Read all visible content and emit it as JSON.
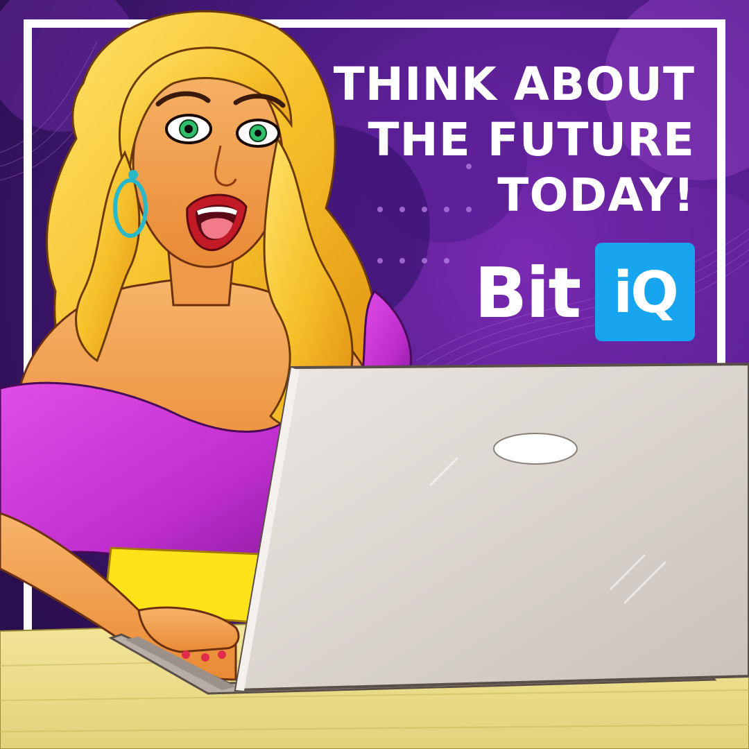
{
  "headline": {
    "line1": "THINK ABOUT",
    "line2": "THE FUTURE",
    "line3": "TODAY!"
  },
  "brand": {
    "word": "Bit",
    "badge": "iQ",
    "badge_color": "#17a5f0"
  },
  "colors": {
    "background": "#4a1a82",
    "frame": "#ffffff",
    "top_color": "#c22fd0",
    "laptop": "#d9d2cd",
    "desk": "#eadf8c"
  }
}
